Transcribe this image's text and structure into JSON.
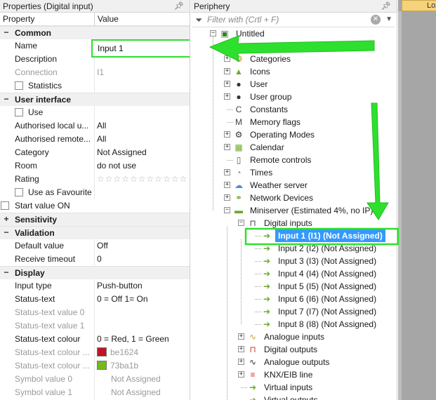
{
  "props": {
    "title": "Properties (Digital input)",
    "col_property": "Property",
    "col_value": "Value",
    "rows": [
      {
        "type": "cat",
        "exp": "−",
        "key": "Common"
      },
      {
        "type": "row",
        "key": "Name",
        "val": ""
      },
      {
        "type": "row",
        "key": "Description",
        "val": ""
      },
      {
        "type": "row",
        "key": "Connection",
        "val": "I1",
        "dim": true
      },
      {
        "type": "cbrow",
        "key": "Statistics",
        "val": ""
      },
      {
        "type": "cat",
        "exp": "−",
        "key": "User interface"
      },
      {
        "type": "cbrow",
        "key": "Use",
        "val": ""
      },
      {
        "type": "row",
        "key": "Authorised local u...",
        "val": "All"
      },
      {
        "type": "row",
        "key": "Authorised remote...",
        "val": "All"
      },
      {
        "type": "row",
        "key": "Category",
        "val": "Not Assigned"
      },
      {
        "type": "row",
        "key": "Room",
        "val": "do not use"
      },
      {
        "type": "stars",
        "key": "Rating",
        "val": "☆☆☆☆☆☆☆☆☆☆☆"
      },
      {
        "type": "cbrow",
        "key": "Use as Favourite",
        "val": ""
      },
      {
        "type": "cbrow2",
        "key": "Start value  ON",
        "val": ""
      },
      {
        "type": "cat",
        "exp": "+",
        "key": "Sensitivity"
      },
      {
        "type": "cat",
        "exp": "−",
        "key": "Validation"
      },
      {
        "type": "row",
        "key": "Default value",
        "val": "Off"
      },
      {
        "type": "row",
        "key": "Receive timeout",
        "val": "0"
      },
      {
        "type": "cat",
        "exp": "−",
        "key": "Display"
      },
      {
        "type": "row",
        "key": "Input type",
        "val": "Push-button"
      },
      {
        "type": "row",
        "key": "Status-text",
        "val": "0 = Off 1= On"
      },
      {
        "type": "row",
        "key": "Status-text value 0",
        "val": "",
        "dim": true
      },
      {
        "type": "row",
        "key": "Status-text value 1",
        "val": "",
        "dim": true
      },
      {
        "type": "row",
        "key": "Status-text colour",
        "val": "0 = Red, 1 = Green"
      },
      {
        "type": "color",
        "key": "Status-text colour ...",
        "val": "be1624",
        "swatch": "#be1624",
        "dim": true
      },
      {
        "type": "color",
        "key": "Status-text colour ...",
        "val": "73ba1b",
        "swatch": "#73ba1b",
        "dim": true
      },
      {
        "type": "row",
        "key": "Symbol value 0",
        "val": "Not Assigned",
        "dim": true
      },
      {
        "type": "row",
        "key": "Symbol value 1",
        "val": "Not Assigned",
        "dim": true
      }
    ],
    "name_value": "Input 1"
  },
  "periphery": {
    "title": "Periphery",
    "filter_placeholder": "Filter with (Crtl + F)",
    "nodes": [
      {
        "level": 0,
        "box": "−",
        "icon": "root-icon",
        "glyph": "▣",
        "color": "#3a7a2a",
        "label": "Untitled"
      },
      {
        "level": 1,
        "box": "+",
        "icon": "blank-icon",
        "glyph": "",
        "color": "#333",
        "label": ""
      },
      {
        "level": 1,
        "box": "+",
        "icon": "categories-icon",
        "glyph": "❂",
        "color": "#c9a227",
        "label": "Categories"
      },
      {
        "level": 1,
        "box": "+",
        "icon": "icons-icon",
        "glyph": "▲",
        "color": "#6aaa2a",
        "label": "Icons"
      },
      {
        "level": 1,
        "box": "+",
        "icon": "user-icon",
        "glyph": "●",
        "color": "#333",
        "label": "User"
      },
      {
        "level": 1,
        "box": "+",
        "icon": "user-group-icon",
        "glyph": "●",
        "color": "#333",
        "label": "User group"
      },
      {
        "level": 1,
        "box": "",
        "icon": "constants-icon",
        "glyph": "C",
        "color": "#444",
        "label": "Constants"
      },
      {
        "level": 1,
        "box": "",
        "icon": "memory-flags-icon",
        "glyph": "M",
        "color": "#444",
        "label": "Memory flags"
      },
      {
        "level": 1,
        "box": "+",
        "icon": "operating-modes-icon",
        "glyph": "⚙",
        "color": "#333",
        "label": "Operating Modes"
      },
      {
        "level": 1,
        "box": "+",
        "icon": "calendar-icon",
        "glyph": "▦",
        "color": "#6aaa2a",
        "label": "Calendar"
      },
      {
        "level": 1,
        "box": "",
        "icon": "remote-controls-icon",
        "glyph": "▯",
        "color": "#555",
        "label": "Remote controls"
      },
      {
        "level": 1,
        "box": "+",
        "icon": "times-icon",
        "glyph": "◔",
        "color": "#6aaa2a",
        "label": "Times"
      },
      {
        "level": 1,
        "box": "+",
        "icon": "weather-server-icon",
        "glyph": "☁",
        "color": "#4a90d9",
        "label": "Weather server"
      },
      {
        "level": 1,
        "box": "+",
        "icon": "network-devices-icon",
        "glyph": "⚭",
        "color": "#6aaa2a",
        "label": "Network Devices"
      },
      {
        "level": 1,
        "box": "−",
        "icon": "miniserver-icon",
        "glyph": "▬",
        "color": "#6aaa2a",
        "label": "Miniserver (Estimated 4%, no IP)"
      },
      {
        "level": 2,
        "box": "−",
        "icon": "digital-inputs-icon",
        "glyph": "⊓",
        "color": "#444",
        "label": "Digital inputs"
      },
      {
        "level": 3,
        "box": "",
        "icon": "input-icon",
        "glyph": "➔",
        "color": "#6aaa2a",
        "label": "Input 1 (I1) (Not Assigned)",
        "selected": true
      },
      {
        "level": 3,
        "box": "",
        "icon": "input-icon",
        "glyph": "➔",
        "color": "#6aaa2a",
        "label": "Input 2 (I2) (Not Assigned)"
      },
      {
        "level": 3,
        "box": "",
        "icon": "input-icon",
        "glyph": "➔",
        "color": "#6aaa2a",
        "label": "Input 3 (I3) (Not Assigned)"
      },
      {
        "level": 3,
        "box": "",
        "icon": "input-icon",
        "glyph": "➔",
        "color": "#6aaa2a",
        "label": "Input 4 (I4) (Not Assigned)"
      },
      {
        "level": 3,
        "box": "",
        "icon": "input-icon",
        "glyph": "➔",
        "color": "#6aaa2a",
        "label": "Input 5 (I5) (Not Assigned)"
      },
      {
        "level": 3,
        "box": "",
        "icon": "input-icon",
        "glyph": "➔",
        "color": "#6aaa2a",
        "label": "Input 6 (I6) (Not Assigned)"
      },
      {
        "level": 3,
        "box": "",
        "icon": "input-icon",
        "glyph": "➔",
        "color": "#6aaa2a",
        "label": "Input 7 (I7) (Not Assigned)"
      },
      {
        "level": 3,
        "box": "",
        "icon": "input-icon",
        "glyph": "➔",
        "color": "#6aaa2a",
        "label": "Input 8 (I8) (Not Assigned)"
      },
      {
        "level": 2,
        "box": "+",
        "icon": "analogue-inputs-icon",
        "glyph": "∿",
        "color": "#c9a227",
        "label": "Analogue inputs"
      },
      {
        "level": 2,
        "box": "+",
        "icon": "digital-outputs-icon",
        "glyph": "⊓",
        "color": "#d9342b",
        "label": "Digital outputs"
      },
      {
        "level": 2,
        "box": "+",
        "icon": "analogue-outputs-icon",
        "glyph": "∿",
        "color": "#333",
        "label": "Analogue outputs"
      },
      {
        "level": 2,
        "box": "+",
        "icon": "knx-eib-line-icon",
        "glyph": "≡",
        "color": "#d9342b",
        "label": "KNX/EIB line"
      },
      {
        "level": 2,
        "box": "",
        "icon": "virtual-inputs-icon",
        "glyph": "➔",
        "color": "#6aaa2a",
        "label": "Virtual inputs"
      },
      {
        "level": 2,
        "box": "",
        "icon": "virtual-outputs-icon",
        "glyph": "➔",
        "color": "#6aaa2a",
        "label": "Virtual outputs"
      }
    ]
  },
  "document_tab": {
    "label": "Loxo"
  },
  "colors": {
    "highlight": "#2ee02e",
    "selection": "#3399ff"
  }
}
